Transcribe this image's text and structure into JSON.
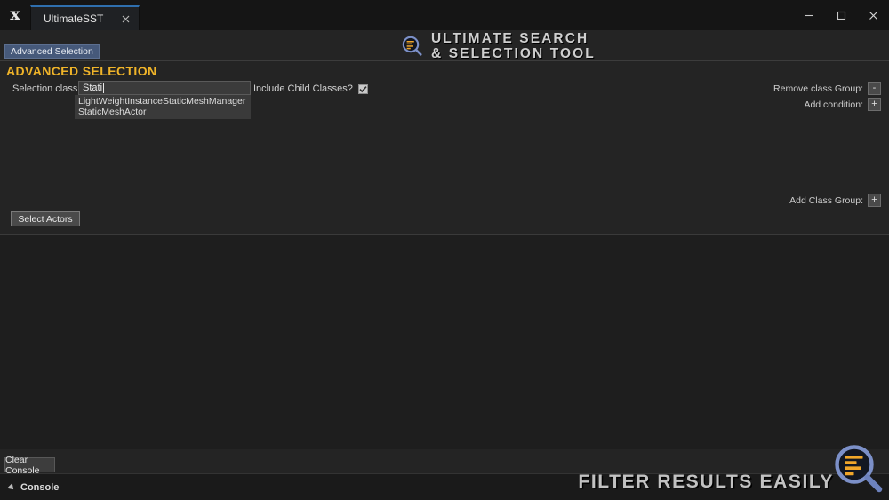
{
  "window": {
    "app_icon": "unreal-engine-logo",
    "tab_label": "UltimateSST",
    "tab_close_icon": "close-icon",
    "minimize_icon": "minimize-icon",
    "maximize_icon": "maximize-icon",
    "close_icon": "close-icon"
  },
  "brand": {
    "logo_icon": "magnifier-list-icon",
    "line1": "ULTIMATE SEARCH",
    "line2": "& SELECTION TOOL"
  },
  "side_tab": {
    "label": "Advanced Selection"
  },
  "section": {
    "title": "ADVANCED SELECTION"
  },
  "form": {
    "selection_class_label": "Selection class:",
    "selection_class_value": "Stati",
    "selection_class_placeholder": "",
    "suggestions": [
      "LightWeightInstanceStaticMeshManager",
      "StaticMeshActor"
    ],
    "include_child_label": "Include Child Classes?",
    "include_child_checked": true,
    "check_icon": "check-icon",
    "remove_class_group_label": "Remove class Group:",
    "remove_class_group_button": "-",
    "add_condition_label": "Add condition:",
    "add_condition_button": "+",
    "add_class_group_label": "Add Class Group:",
    "add_class_group_button": "+",
    "select_actors_button": "Select Actors"
  },
  "console": {
    "clear_button": "Clear Console",
    "panel_label": "Console",
    "collapse_icon": "triangle-collapse-icon",
    "output_text": ""
  },
  "watermark": {
    "text": "FILTER RESULTS EASILY",
    "logo_icon": "magnifier-list-icon"
  },
  "colors": {
    "accent_orange": "#f0b429",
    "tab_active_blue": "#2f6fae",
    "side_tab_blue": "#46597a",
    "logo_ring_blue": "#7c90c8",
    "logo_bar_orange": "#f0a62a",
    "window_bg": "#242424",
    "titlebar_bg": "#151515",
    "panel_bg": "#1e1e1e"
  }
}
